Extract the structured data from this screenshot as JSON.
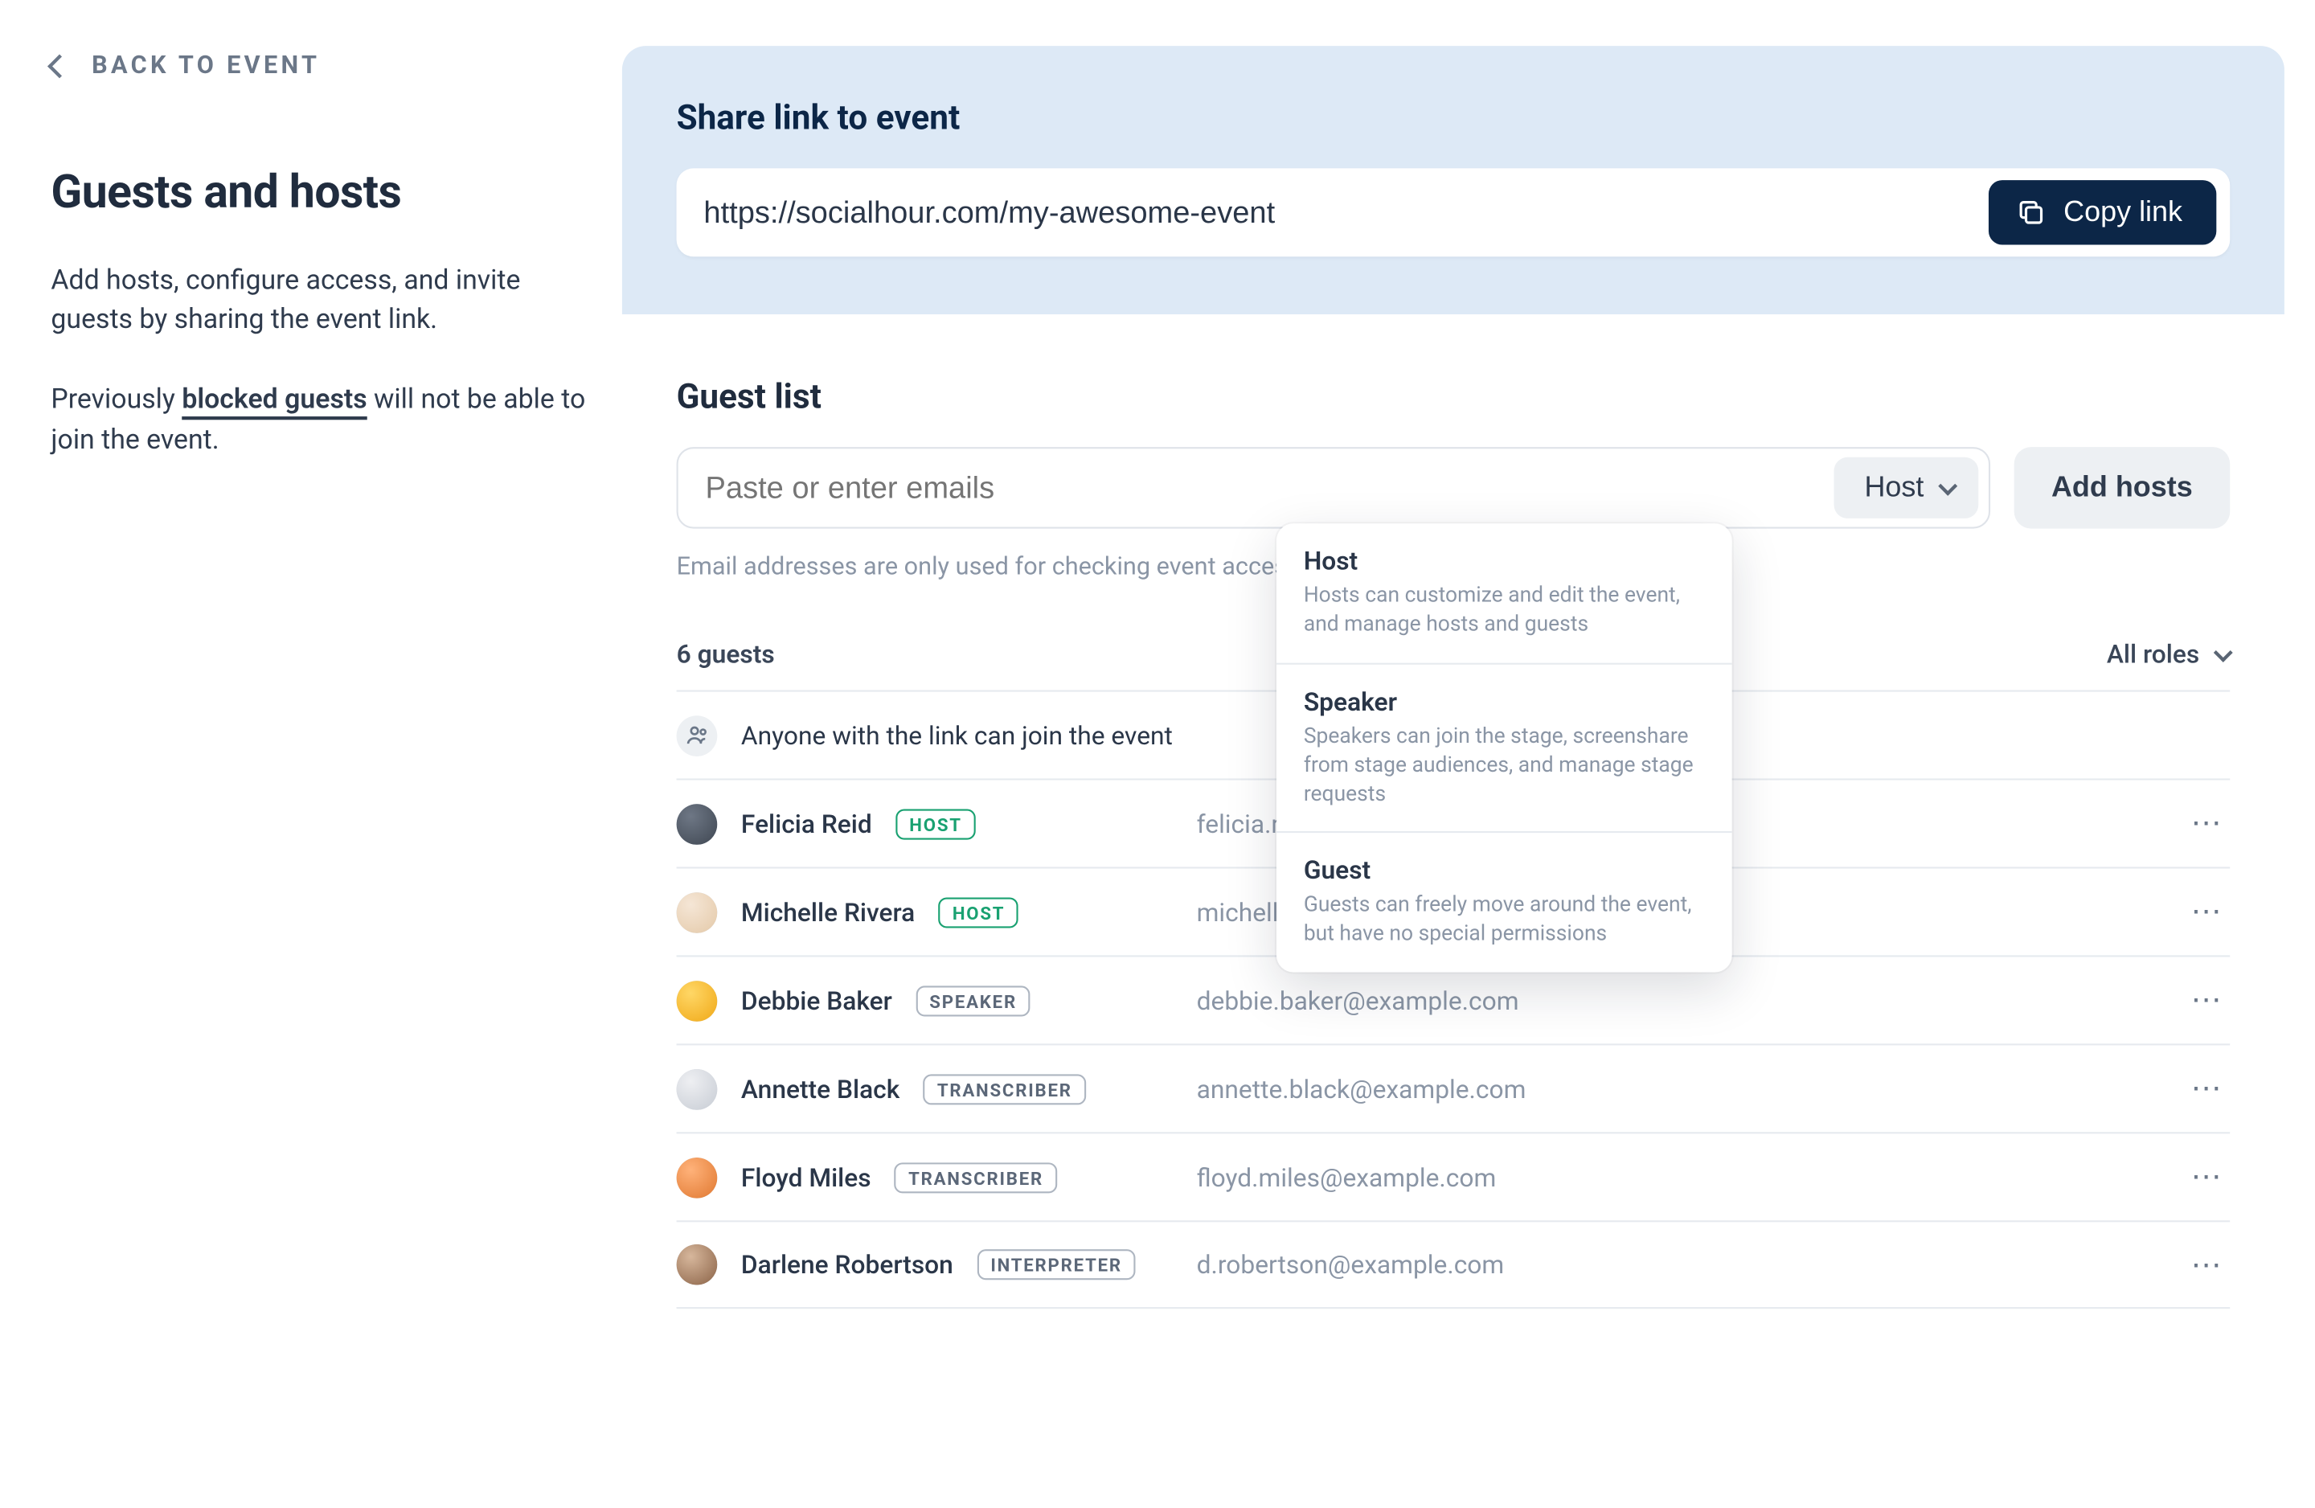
{
  "back_label": "BACK TO EVENT",
  "page_title": "Guests and hosts",
  "intro_1": "Add hosts, configure access, and invite guests by sharing the event link.",
  "intro_2a": "Previously ",
  "intro_2_link": "blocked guests",
  "intro_2b": " will not be able to join the event.",
  "share": {
    "title": "Share link to event",
    "url": "https://socialhour.com/my-awesome-event",
    "copy_label": "Copy link"
  },
  "guestlist": {
    "title": "Guest list",
    "email_placeholder": "Paste or enter emails",
    "role_selected": "Host",
    "add_label": "Add hosts",
    "hint": "Email addresses are only used for checking event access. An invite will not be sent.",
    "count_label": "6 guests",
    "filter_label": "All roles"
  },
  "role_options": [
    {
      "title": "Host",
      "desc": "Hosts can customize and edit the event, and manage hosts and guests"
    },
    {
      "title": "Speaker",
      "desc": "Speakers can join the stage, screenshare from stage audiences, and manage stage requests"
    },
    {
      "title": "Guest",
      "desc": "Guests can freely move around the event, but have no special permissions"
    }
  ],
  "anyone_row": "Anyone with the link can join the event",
  "guests": [
    {
      "name": "Felicia Reid",
      "email": "felicia.reid@example.com",
      "role": "HOST",
      "pill": "green",
      "avatar": "c-grey"
    },
    {
      "name": "Michelle Rivera",
      "email": "michelle.rivera@example.com",
      "role": "HOST",
      "pill": "green",
      "avatar": "c-tan"
    },
    {
      "name": "Debbie Baker",
      "email": "debbie.baker@example.com",
      "role": "SPEAKER",
      "pill": "slate",
      "avatar": "c-yel"
    },
    {
      "name": "Annette Black",
      "email": "annette.black@example.com",
      "role": "TRANSCRIBER",
      "pill": "slate",
      "avatar": "c-pale"
    },
    {
      "name": "Floyd Miles",
      "email": "floyd.miles@example.com",
      "role": "TRANSCRIBER",
      "pill": "slate",
      "avatar": "c-org"
    },
    {
      "name": "Darlene Robertson",
      "email": "d.robertson@example.com",
      "role": "INTERPRETER",
      "pill": "slate",
      "avatar": "c-brown"
    }
  ]
}
